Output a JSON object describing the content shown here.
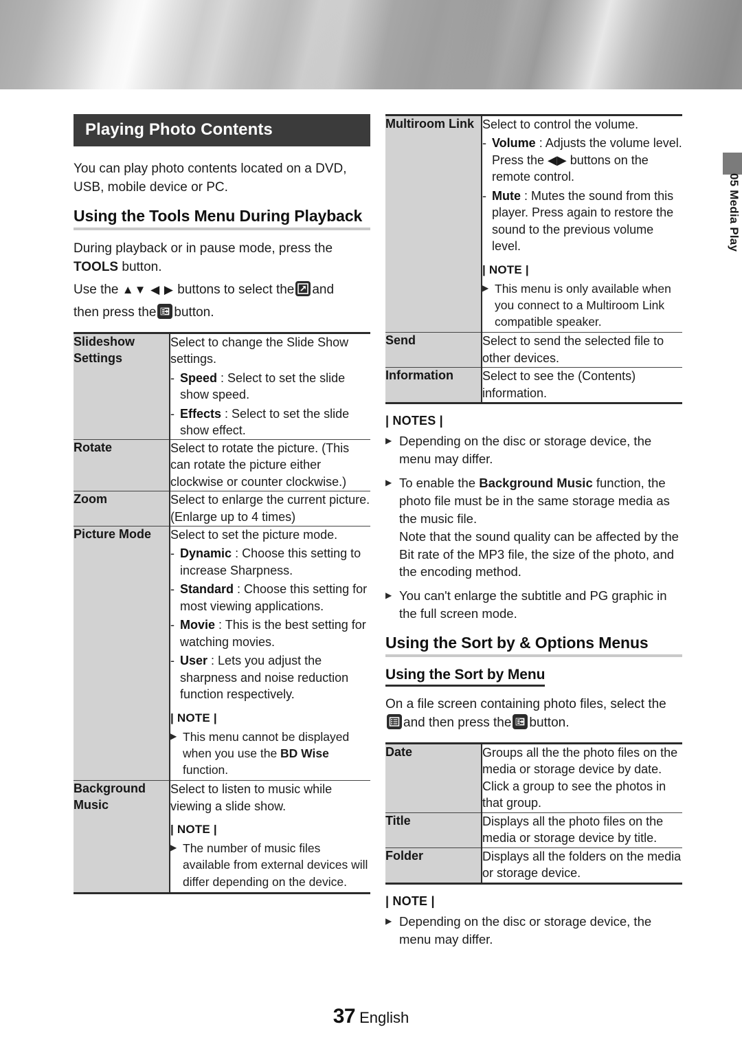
{
  "chapter_tab": {
    "label": "05  Media Play"
  },
  "footer": {
    "page_number": "37",
    "language": "English"
  },
  "left": {
    "section_title": "Playing Photo Contents",
    "intro": "You can play photo contents located on a DVD, USB, mobile device or PC.",
    "heading": "Using the Tools Menu During Playback",
    "instruction_line1_a": "During playback or in pause mode, press the",
    "instruction_line1_b": "TOOLS",
    "instruction_line1_c": "button.",
    "instruction_line2_a": "Use the",
    "instruction_arrows": "▲▼ ◀ ▶",
    "instruction_line2_b": "buttons to select the",
    "instruction_line2_c": "and",
    "instruction_line3_a": "then press the",
    "instruction_line3_b": "button.",
    "icons": {
      "tools": "tools-icon",
      "enter": "enter-icon"
    },
    "table": [
      {
        "key": "Slideshow Settings",
        "intro": "Select to change the Slide Show settings.",
        "dashes": [
          {
            "term": "Speed",
            "text": ": Select to set the slide show speed."
          },
          {
            "term": "Effects",
            "text": ": Select to set the slide show effect."
          }
        ]
      },
      {
        "key": "Rotate",
        "intro": "Select to rotate the picture. (This can rotate the picture either clockwise or counter clockwise.)"
      },
      {
        "key": "Zoom",
        "intro": "Select to enlarge the current picture. (Enlarge up to 4 times)"
      },
      {
        "key": "Picture Mode",
        "intro": "Select to set the picture mode.",
        "dashes": [
          {
            "term": "Dynamic",
            "text": ": Choose this setting to increase Sharpness."
          },
          {
            "term": "Standard",
            "text": ": Choose this setting for most viewing applications."
          },
          {
            "term": "Movie",
            "text": ": This is the best setting for watching movies."
          },
          {
            "term": "User",
            "text": ": Lets you adjust the sharpness and noise reduction function respectively."
          }
        ],
        "note_label": "| NOTE |",
        "note_bullets_rich": [
          {
            "pre": "This menu cannot be displayed when you use the ",
            "bold": "BD Wise",
            "post": " function."
          }
        ]
      },
      {
        "key": "Background Music",
        "intro": "Select to listen to music while viewing a slide show.",
        "note_label": "| NOTE |",
        "note_bullets": [
          "The number of music files available from external devices will differ depending on the device."
        ]
      }
    ]
  },
  "right": {
    "table_top": [
      {
        "key": "Multiroom Link",
        "intro": "Select to control the volume.",
        "dashes": [
          {
            "term": "Volume",
            "text": ": Adjusts the volume level. Press the ◀▶ buttons on the remote control."
          },
          {
            "term": "Mute",
            "text": ": Mutes the sound from this player. Press again to restore the sound to the previous volume level."
          }
        ],
        "note_label": "| NOTE |",
        "note_bullets": [
          "This menu is only available when you connect to a Multiroom Link compatible speaker."
        ]
      },
      {
        "key": "Send",
        "intro": "Select to send the selected file to other devices."
      },
      {
        "key": "Information",
        "intro": "Select to see the (Contents) information."
      }
    ],
    "notes_label": "| NOTES |",
    "notes": [
      {
        "text": "Depending on the disc or storage device, the menu may differ."
      },
      {
        "pre": "To enable the ",
        "bold": "Background Music",
        "post": " function, the photo file must be in the same storage media as the music file.\nNote that the sound quality can be affected by the Bit rate of the MP3 file, the size of the photo, and the encoding method."
      },
      {
        "text": "You can't enlarge the subtitle and PG graphic in the full screen mode."
      }
    ],
    "heading2": "Using the Sort by & Options Menus",
    "heading3": "Using the Sort by Menu",
    "sortby_line_a": "On a file screen containing photo files, select the",
    "sortby_line_b": "and then press the",
    "sortby_line_c": "button.",
    "icons": {
      "list": "list-icon",
      "enter": "enter-icon"
    },
    "table_sort": [
      {
        "key": "Date",
        "intro": "Groups all the the photo files on the media or storage device by date.\nClick a group to see the photos in that group."
      },
      {
        "key": "Title",
        "intro": "Displays all the photo files on the media or storage device by title."
      },
      {
        "key": "Folder",
        "intro": "Displays all the folders on the media or storage device."
      }
    ],
    "note_label": "| NOTE |",
    "note_bullets": [
      "Depending on the disc or storage device, the menu may differ."
    ]
  }
}
